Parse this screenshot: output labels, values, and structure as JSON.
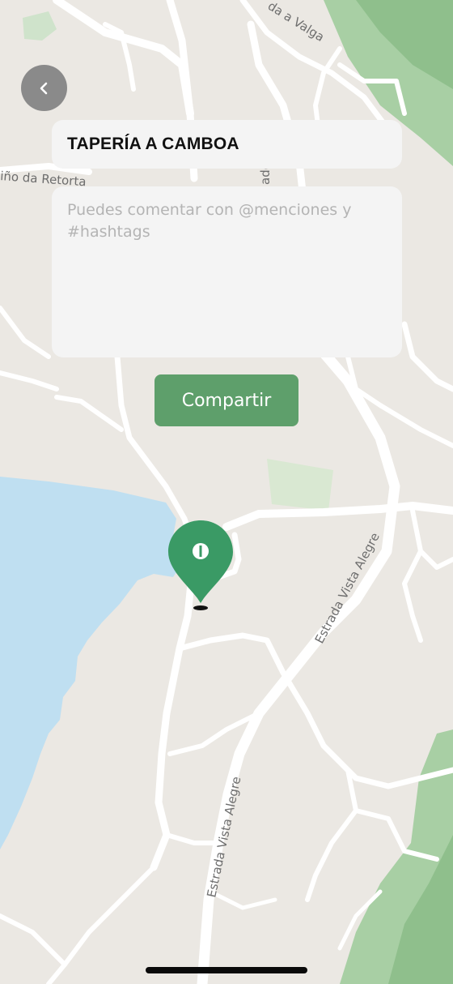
{
  "colors": {
    "map_land": "#ebe8e3",
    "water": "#bfdff1",
    "park": "#a8cfa4",
    "road": "#ffffff",
    "accent": "#5e9f6b",
    "pin": "#3a9a65",
    "back_button": "#8a8a8a"
  },
  "header": {
    "back_icon": "chevron-left-icon",
    "place_title": "TAPERÍA A CAMBOA"
  },
  "comment": {
    "placeholder": "Puedes comentar con @menciones y #hashtags",
    "value": ""
  },
  "actions": {
    "share_label": "Compartir"
  },
  "map": {
    "marker_icon": "location-pin-icon",
    "street_labels": {
      "valga": "da a Valga",
      "retorta": "iño da Retorta",
      "vertical_top": "ado",
      "vista_alegre_1": "Estrada Vista Alegre",
      "vista_alegre_2": "Estrada Vista Alegre"
    }
  }
}
